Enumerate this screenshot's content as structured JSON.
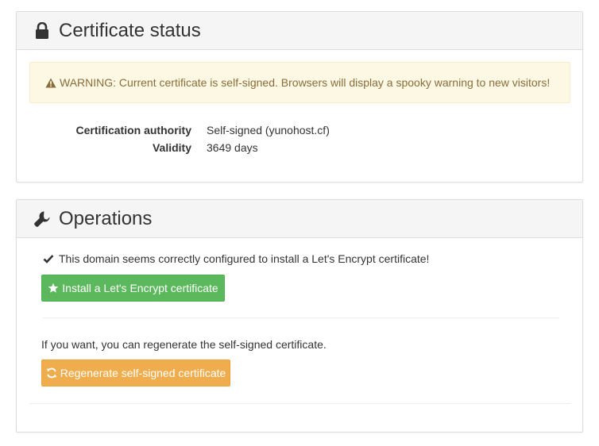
{
  "certificate_panel": {
    "title": "Certificate status",
    "icon": "lock-icon",
    "warning": {
      "icon": "warning-triangle-icon",
      "text": "WARNING: Current certificate is self-signed. Browsers will display a spooky warning to new visitors!"
    },
    "details": [
      {
        "label": "Certification authority",
        "value": "Self-signed (yunohost.cf)"
      },
      {
        "label": "Validity",
        "value": "3649 days"
      }
    ]
  },
  "operations_panel": {
    "title": "Operations",
    "icon": "wrench-icon",
    "ok_message": "This domain seems correctly configured to install a Let's Encrypt certificate!",
    "install_button": "Install a Let's Encrypt certificate",
    "regen_text": "If you want, you can regenerate the self-signed certificate.",
    "regen_button": "Regenerate self-signed certificate"
  },
  "colors": {
    "warning_bg": "#fcf8e3",
    "warning_text": "#8a6d3b",
    "success": "#5cb85c",
    "warning_button": "#f0ad4e"
  }
}
